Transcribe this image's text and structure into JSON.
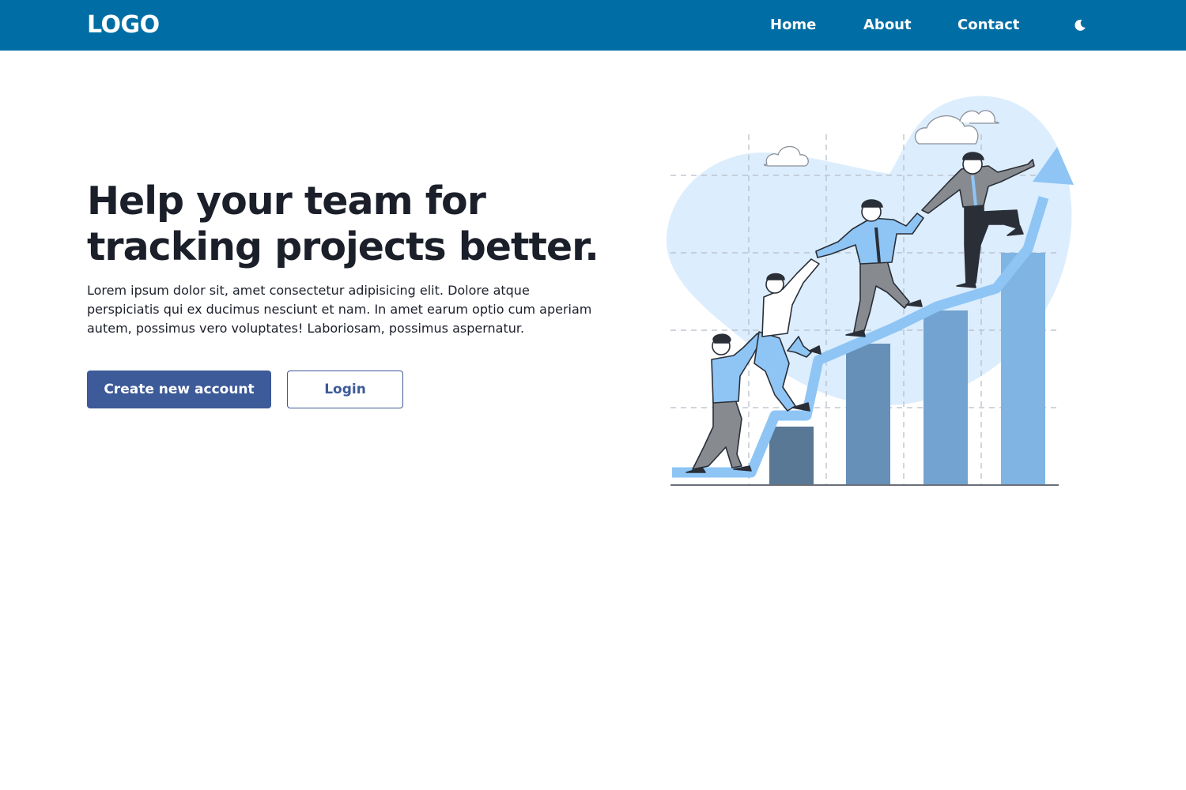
{
  "nav": {
    "logo": "LOGO",
    "links": [
      "Home",
      "About",
      "Contact"
    ],
    "theme_icon": "moon-icon"
  },
  "hero": {
    "title_line1": "Help your team for",
    "title_line2": "tracking projects better.",
    "description": "Lorem ipsum dolor sit, amet consectetur adipisicing elit. Dolore atque perspiciatis qui ex ducimus nesciunt et nam. In amet earum optio cum aperiam autem, possimus vero voluptates! Laboriosam, possimus aspernatur.",
    "primary_button": "Create new account",
    "secondary_button": "Login"
  },
  "illustration": {
    "subject": "team-climbing-growth-chart"
  },
  "colors": {
    "navbar": "#006ea5",
    "primary_button": "#3d5a99",
    "heading_text": "#1b1f2a",
    "blob": "#dcedfd",
    "arrow": "#8ec5f5",
    "bars": [
      "#587895",
      "#6690b8",
      "#73a3d0",
      "#7fb4e3"
    ]
  }
}
